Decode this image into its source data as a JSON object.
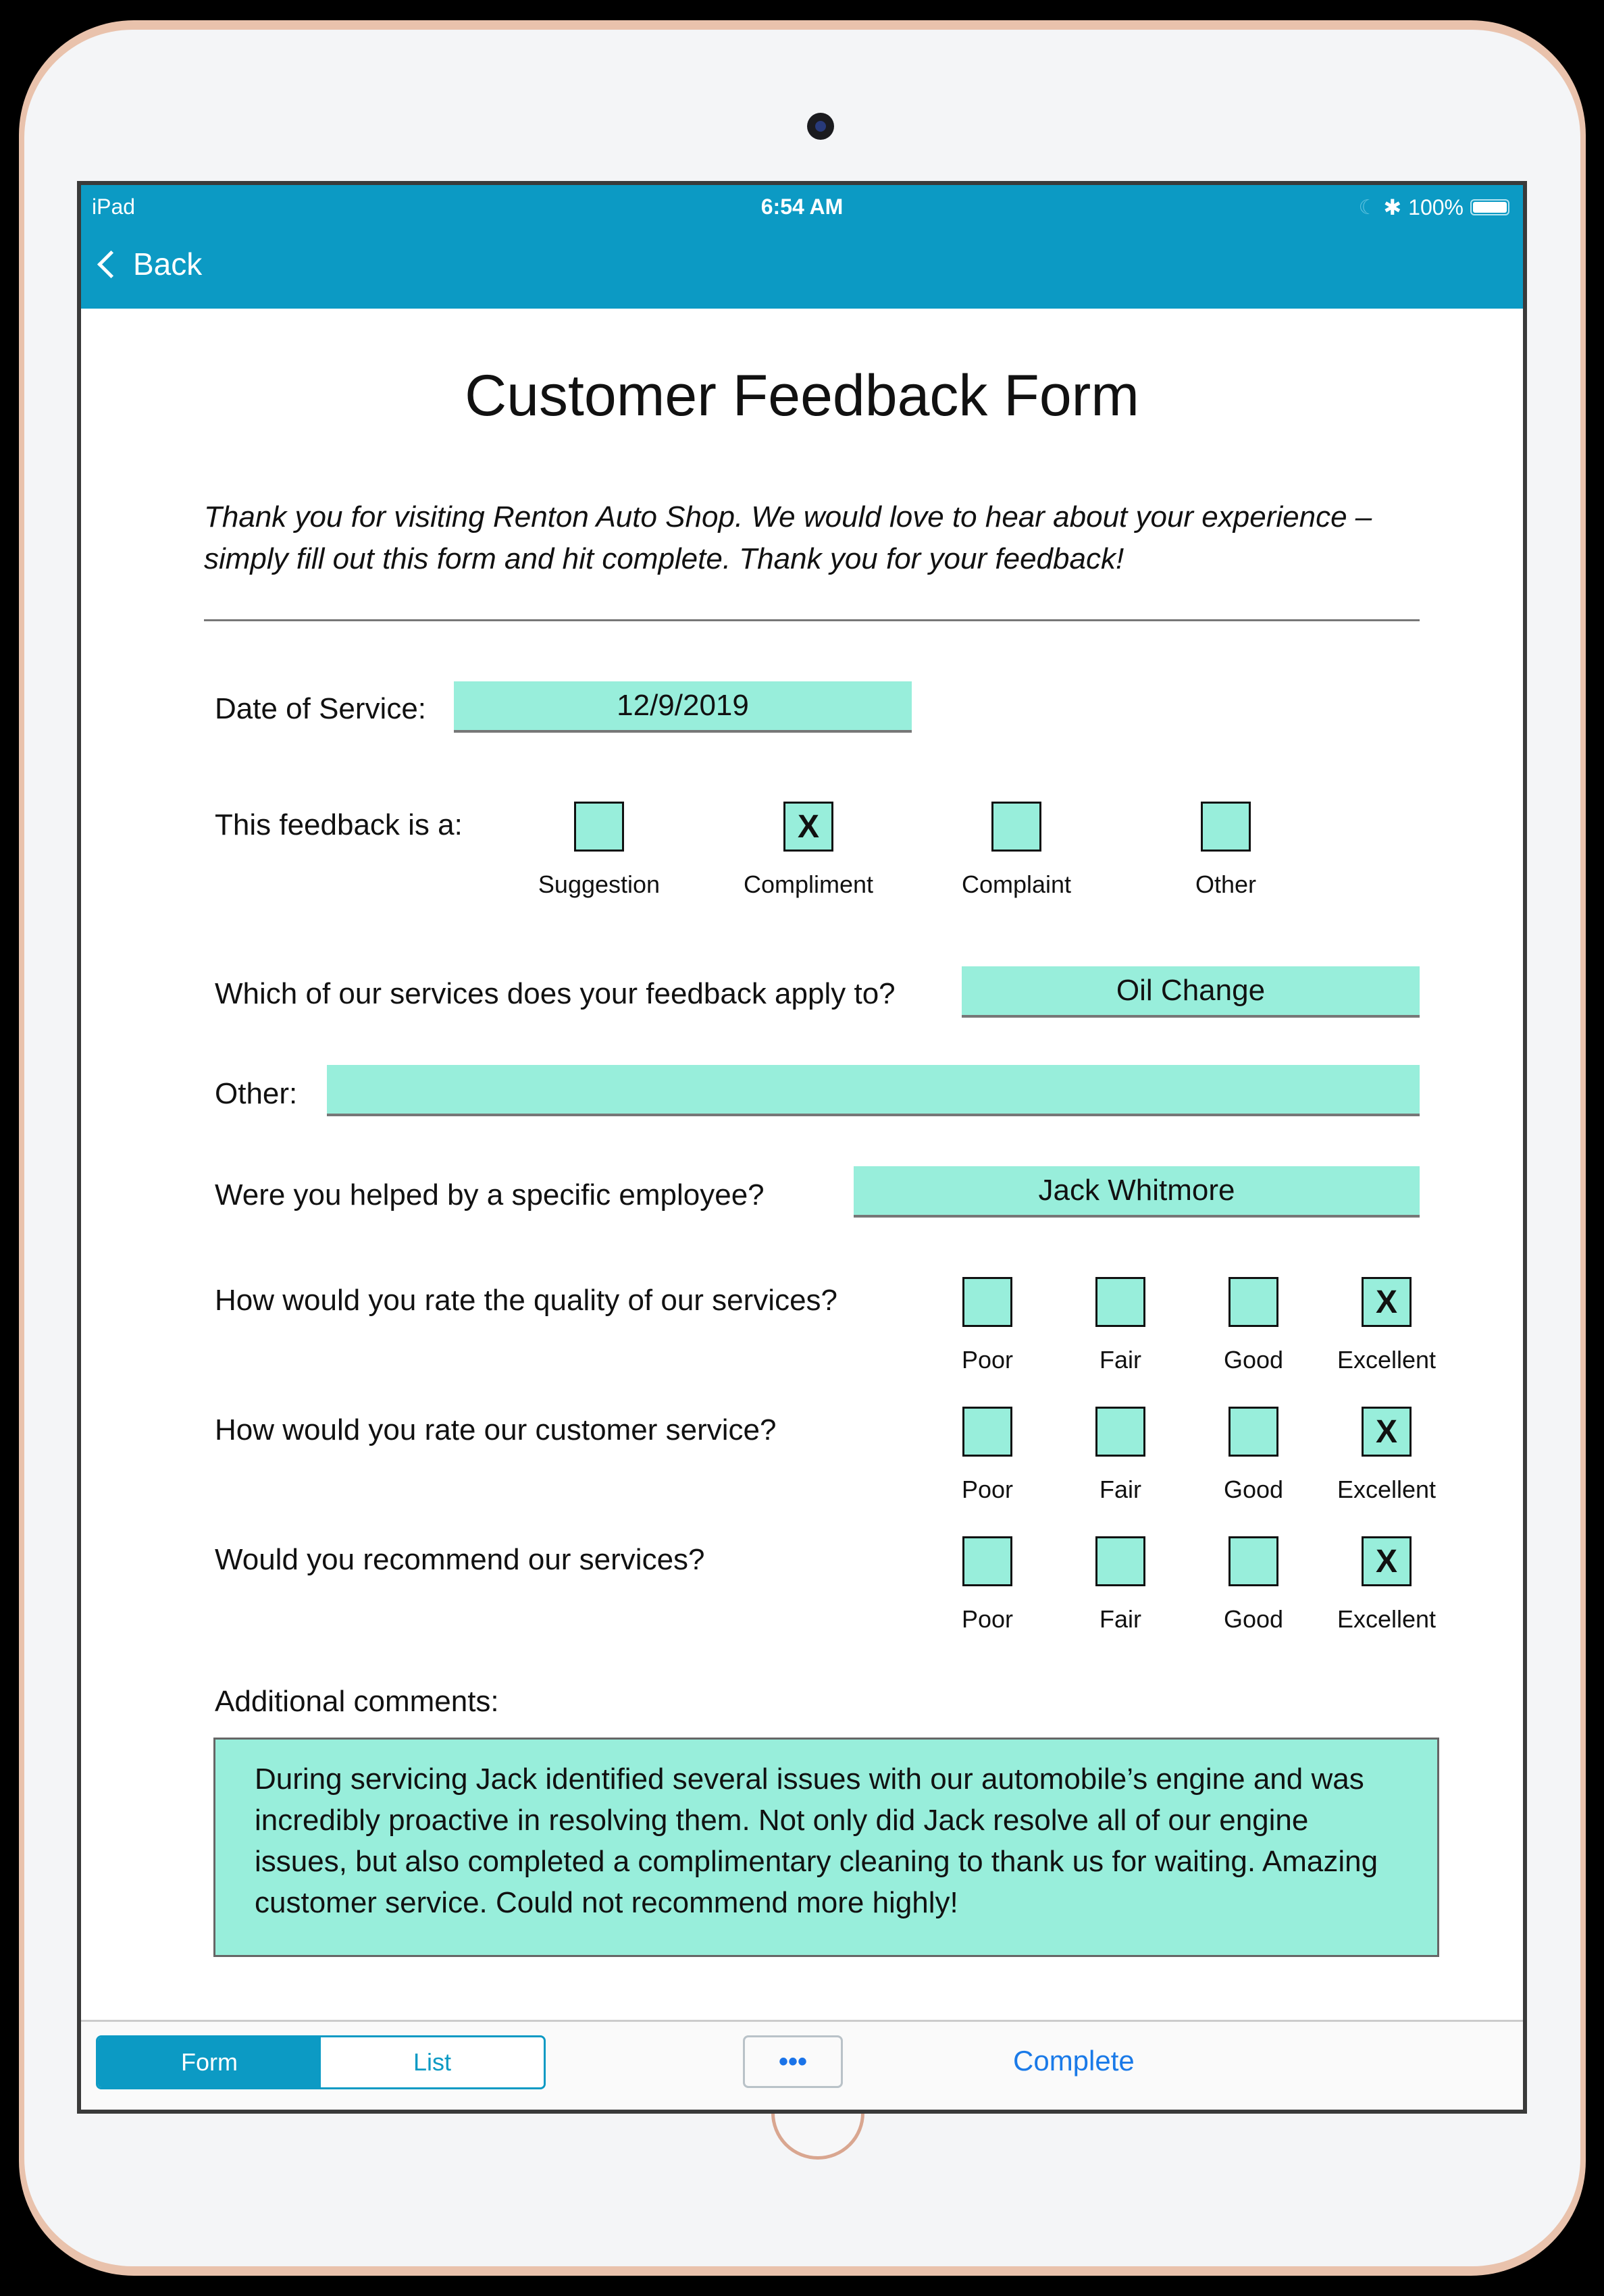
{
  "status_bar": {
    "device": "iPad",
    "time": "6:54 AM",
    "battery": "100%"
  },
  "nav": {
    "back_label": "Back"
  },
  "form": {
    "title": "Customer Feedback Form",
    "intro": "Thank you for visiting Renton Auto Shop. We would love to hear about your experience – simply fill out this form and hit complete. Thank you for your feedback!",
    "date_label": "Date of Service:",
    "date_value": "12/9/2019",
    "type_label": "This feedback is a:",
    "type_options": [
      {
        "label": "Suggestion",
        "mark": ""
      },
      {
        "label": "Compliment",
        "mark": "X"
      },
      {
        "label": "Complaint",
        "mark": ""
      },
      {
        "label": "Other",
        "mark": ""
      }
    ],
    "service_label": "Which of our services does your feedback apply to?",
    "service_value": "Oil Change",
    "other_label": "Other:",
    "other_value": "",
    "employee_label": "Were you helped by a specific employee?",
    "employee_value": "Jack Whitmore",
    "rating_options": [
      "Poor",
      "Fair",
      "Good",
      "Excellent"
    ],
    "ratings": [
      {
        "question": "How would you rate the quality of our services?",
        "marks": [
          "",
          "",
          "",
          "X"
        ]
      },
      {
        "question": "How would you rate our customer service?",
        "marks": [
          "",
          "",
          "",
          "X"
        ]
      },
      {
        "question": "Would you recommend our services?",
        "marks": [
          "",
          "",
          "",
          "X"
        ]
      }
    ],
    "comments_label": "Additional comments:",
    "comments_value": "During servicing Jack identified several issues with our automobile’s engine and was incredibly proactive in resolving them. Not only did Jack resolve all of our engine issues, but also completed a complimentary cleaning to thank us for waiting. Amazing customer service. Could not recommend more highly!"
  },
  "toolbar": {
    "form_tab": "Form",
    "list_tab": "List",
    "more_label": "•••",
    "complete_label": "Complete"
  }
}
